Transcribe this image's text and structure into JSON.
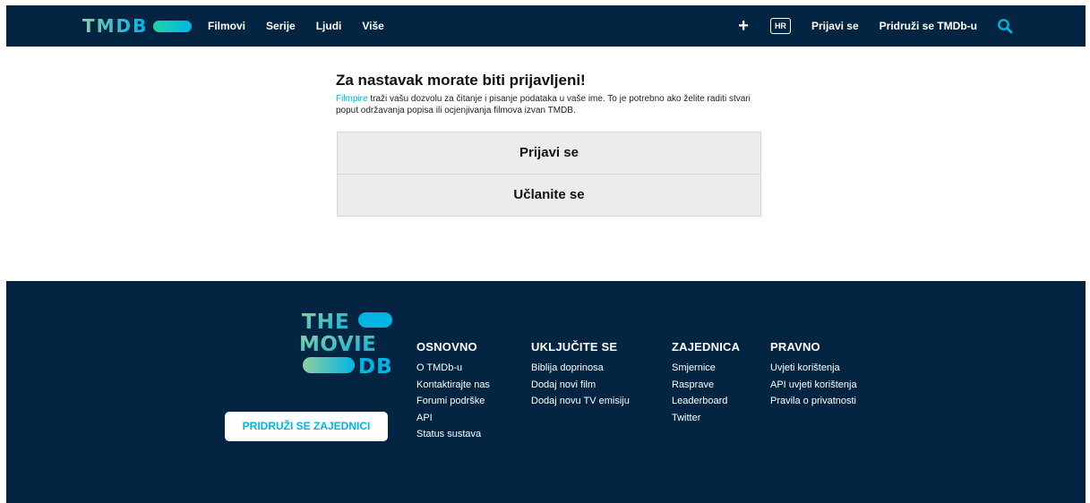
{
  "header": {
    "logo_text": "TMDB",
    "nav_left": [
      "Filmovi",
      "Serije",
      "Ljudi",
      "Više"
    ],
    "language": "HR",
    "login": "Prijavi se",
    "join": "Pridruži se TMDb-u"
  },
  "main": {
    "title": "Za nastavak morate biti prijavljeni!",
    "app_name": "Filmpire",
    "description": " traži vašu dozvolu za čitanje i pisanje podataka u vaše ime. To je potrebno ako želite raditi stvari poput održavanja popisa ili ocjenjivanja filmova izvan TMDB.",
    "login_button": "Prijavi se",
    "signup_button": "Učlanite se"
  },
  "footer": {
    "logo_lines": [
      "THE",
      "MOVIE",
      "DB"
    ],
    "join_button": "PRIDRUŽI SE ZAJEDNICI",
    "columns": [
      {
        "title": "OSNOVNO",
        "links": [
          "O TMDb-u",
          "Kontaktirajte nas",
          "Forumi podrške",
          "API",
          "Status sustava"
        ]
      },
      {
        "title": "UKLJUČITE SE",
        "links": [
          "Biblija doprinosa",
          "Dodaj novi film",
          "Dodaj novu TV emisiju"
        ]
      },
      {
        "title": "ZAJEDNICA",
        "links": [
          "Smjernice",
          "Rasprave",
          "Leaderboard",
          "Twitter"
        ]
      },
      {
        "title": "PRAVNO",
        "links": [
          "Uvjeti korištenja",
          "API uvjeti korištenja",
          "Pravila o privatnosti"
        ]
      }
    ]
  },
  "colors": {
    "navy": "#032541",
    "accent_blue": "#01b4e4",
    "accent_green": "#90cea1"
  },
  "icons": [
    "plus-icon",
    "search-icon"
  ]
}
